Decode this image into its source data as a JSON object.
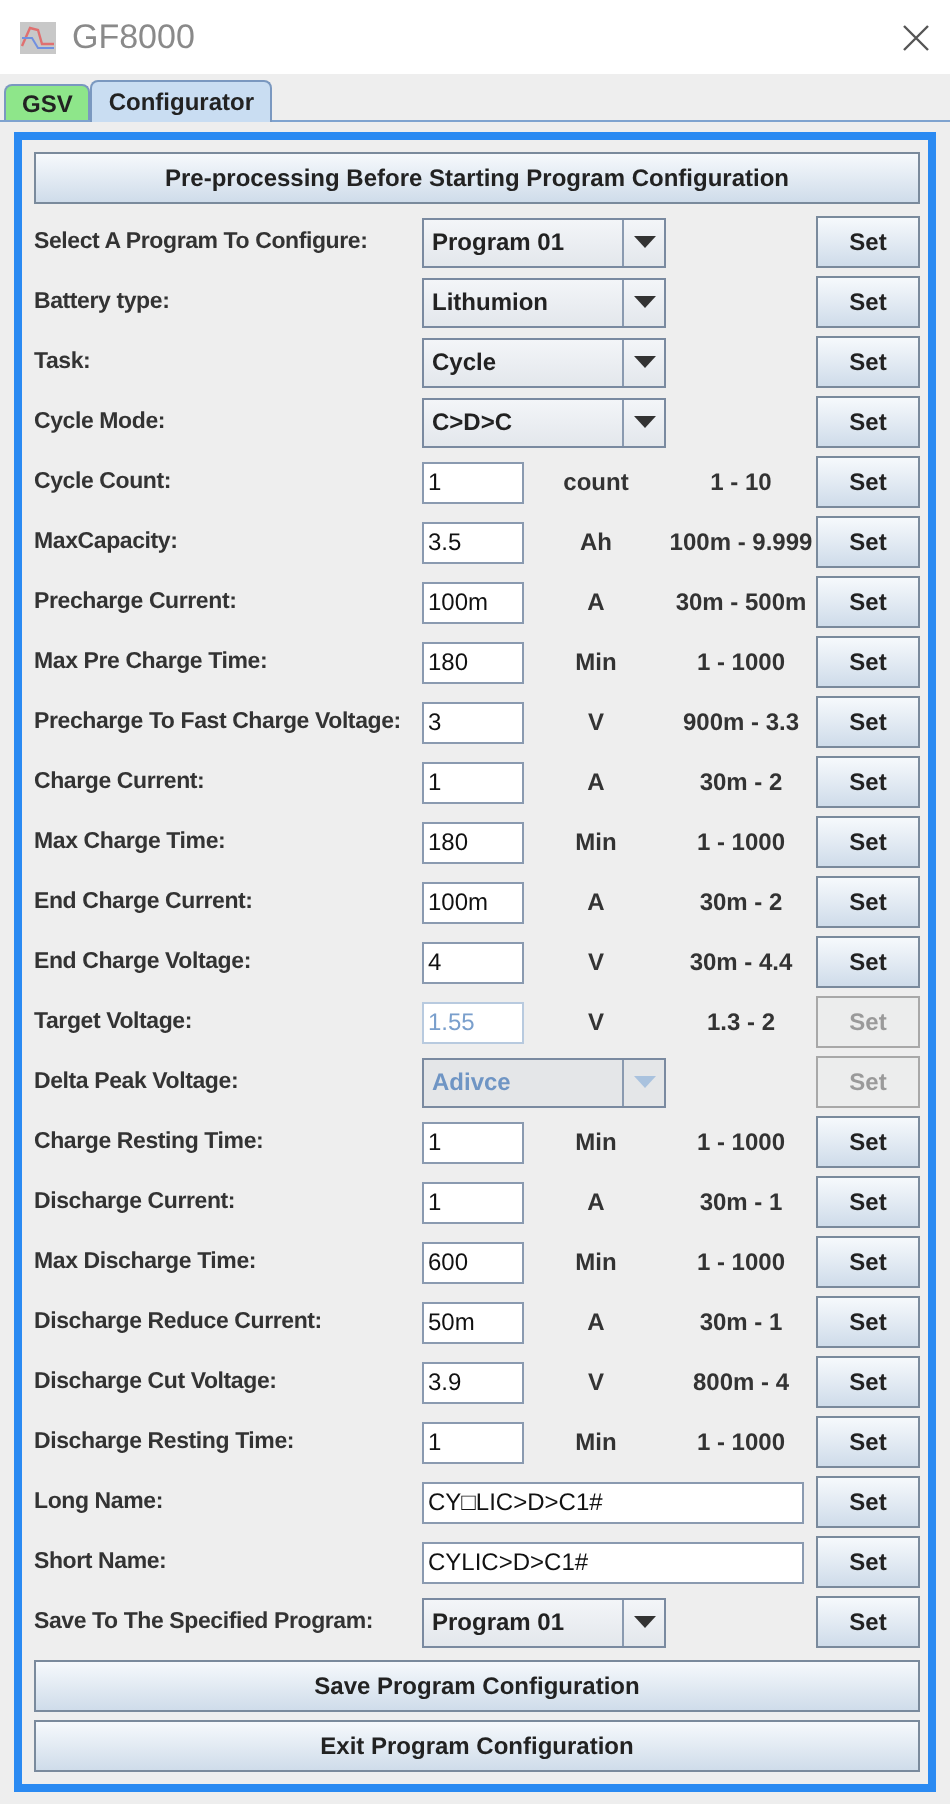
{
  "window": {
    "title": "GF8000"
  },
  "tabs": [
    {
      "label": "GSV",
      "selected": false,
      "color": "#8ee68a"
    },
    {
      "label": "Configurator",
      "selected": true,
      "color": "#c9ddf2"
    }
  ],
  "top_button": "Pre-processing Before Starting Program Configuration",
  "rows": [
    {
      "kind": "select",
      "label": "Select A Program To Configure:",
      "value": "Program 01",
      "disabled": false,
      "button": "Set"
    },
    {
      "kind": "select",
      "label": "Battery type:",
      "value": "Lithumion",
      "disabled": false,
      "button": "Set"
    },
    {
      "kind": "select",
      "label": "Task:",
      "value": "Cycle",
      "disabled": false,
      "button": "Set"
    },
    {
      "kind": "select",
      "label": "Cycle Mode:",
      "value": "C>D>C",
      "disabled": false,
      "button": "Set"
    },
    {
      "kind": "number",
      "label": "Cycle Count:",
      "value": "1",
      "unit": "count",
      "range": "1 - 10",
      "disabled": false,
      "button": "Set"
    },
    {
      "kind": "number",
      "label": "MaxCapacity:",
      "value": "3.5",
      "unit": "Ah",
      "range": "100m - 9.999",
      "disabled": false,
      "button": "Set"
    },
    {
      "kind": "number",
      "label": "Precharge Current:",
      "value": "100m",
      "unit": "A",
      "range": "30m - 500m",
      "disabled": false,
      "button": "Set"
    },
    {
      "kind": "number",
      "label": "Max Pre Charge Time:",
      "value": "180",
      "unit": "Min",
      "range": "1 - 1000",
      "disabled": false,
      "button": "Set"
    },
    {
      "kind": "number",
      "label": "Precharge To Fast Charge Voltage:",
      "value": "3",
      "unit": "V",
      "range": "900m - 3.3",
      "disabled": false,
      "button": "Set"
    },
    {
      "kind": "number",
      "label": "Charge Current:",
      "value": "1",
      "unit": "A",
      "range": "30m - 2",
      "disabled": false,
      "button": "Set"
    },
    {
      "kind": "number",
      "label": "Max Charge Time:",
      "value": "180",
      "unit": "Min",
      "range": "1 - 1000",
      "disabled": false,
      "button": "Set"
    },
    {
      "kind": "number",
      "label": "End Charge Current:",
      "value": "100m",
      "unit": "A",
      "range": "30m - 2",
      "disabled": false,
      "button": "Set"
    },
    {
      "kind": "number",
      "label": "End Charge Voltage:",
      "value": "4",
      "unit": "V",
      "range": "30m - 4.4",
      "disabled": false,
      "button": "Set"
    },
    {
      "kind": "number",
      "label": "Target Voltage:",
      "value": "1.55",
      "unit": "V",
      "range": "1.3 - 2",
      "disabled": true,
      "button": "Set"
    },
    {
      "kind": "select",
      "label": "Delta Peak Voltage:",
      "value": "Adivce",
      "disabled": true,
      "button": "Set"
    },
    {
      "kind": "number",
      "label": "Charge Resting Time:",
      "value": "1",
      "unit": "Min",
      "range": "1 - 1000",
      "disabled": false,
      "button": "Set"
    },
    {
      "kind": "number",
      "label": "Discharge Current:",
      "value": "1",
      "unit": "A",
      "range": "30m - 1",
      "disabled": false,
      "button": "Set"
    },
    {
      "kind": "number",
      "label": "Max Discharge Time:",
      "value": "600",
      "unit": "Min",
      "range": "1 - 1000",
      "disabled": false,
      "button": "Set"
    },
    {
      "kind": "number",
      "label": "Discharge Reduce Current:",
      "value": "50m",
      "unit": "A",
      "range": "30m - 1",
      "disabled": false,
      "button": "Set"
    },
    {
      "kind": "number",
      "label": "Discharge Cut Voltage:",
      "value": "3.9",
      "unit": "V",
      "range": "800m - 4",
      "disabled": false,
      "button": "Set"
    },
    {
      "kind": "number",
      "label": "Discharge Resting Time:",
      "value": "1",
      "unit": "Min",
      "range": "1 - 1000",
      "disabled": false,
      "button": "Set"
    },
    {
      "kind": "text",
      "label": "Long Name:",
      "value": "CY□LIC>D>C1#",
      "disabled": false,
      "button": "Set"
    },
    {
      "kind": "text",
      "label": "Short Name:",
      "value": "CYLIC>D>C1#",
      "disabled": false,
      "button": "Set"
    },
    {
      "kind": "select",
      "label": "Save To The Specified Program:",
      "value": "Program 01",
      "disabled": false,
      "button": "Set"
    }
  ],
  "bottom_buttons": [
    "Save Program Configuration",
    "Exit Program Configuration"
  ]
}
